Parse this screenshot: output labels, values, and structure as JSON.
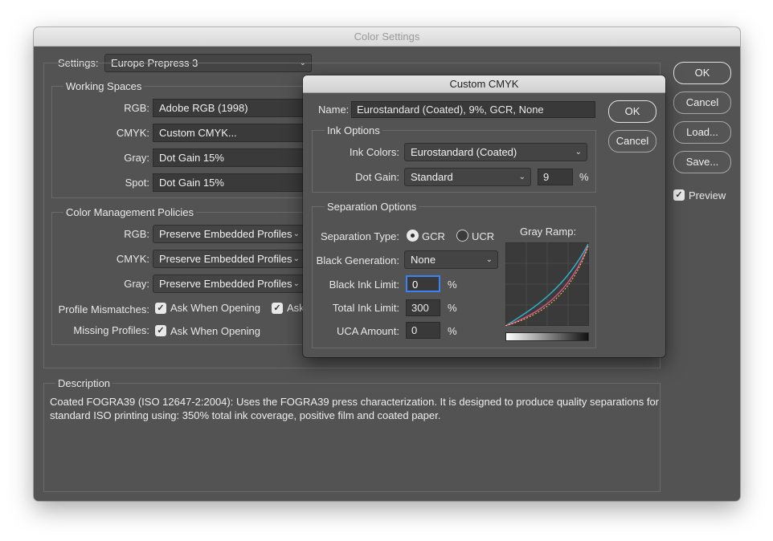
{
  "window": {
    "title": "Color Settings"
  },
  "settings": {
    "label": "Settings:",
    "value": "Europe Prepress 3"
  },
  "working_spaces": {
    "title": "Working Spaces",
    "rows": [
      {
        "label": "RGB:",
        "value": "Adobe RGB (1998)"
      },
      {
        "label": "CMYK:",
        "value": "Custom CMYK..."
      },
      {
        "label": "Gray:",
        "value": "Dot Gain 15%"
      },
      {
        "label": "Spot:",
        "value": "Dot Gain 15%"
      }
    ]
  },
  "policies": {
    "title": "Color Management Policies",
    "rows": [
      {
        "label": "RGB:",
        "value": "Preserve Embedded Profiles"
      },
      {
        "label": "CMYK:",
        "value": "Preserve Embedded Profiles"
      },
      {
        "label": "Gray:",
        "value": "Preserve Embedded Profiles"
      }
    ],
    "profile_mismatches": {
      "label": "Profile Mismatches:",
      "opt1": "Ask When Opening",
      "opt2": "Ask"
    },
    "missing_profiles": {
      "label": "Missing Profiles:",
      "opt1": "Ask When Opening"
    }
  },
  "description": {
    "title": "Description",
    "line1": "Coated FOGRA39 (ISO 12647-2:2004):  Uses the FOGRA39 press characterization. It is designed to produce quality separations for",
    "line2": "standard ISO printing using: 350% total ink coverage, positive film and coated paper."
  },
  "buttons": {
    "ok": "OK",
    "cancel": "Cancel",
    "load": "Load...",
    "save": "Save...",
    "preview": "Preview"
  },
  "custom_cmyk": {
    "title": "Custom CMYK",
    "name_label": "Name:",
    "name_value": "Eurostandard (Coated), 9%, GCR, None",
    "ok": "OK",
    "cancel": "Cancel",
    "ink_options": {
      "title": "Ink Options",
      "ink_colors_label": "Ink Colors:",
      "ink_colors_value": "Eurostandard (Coated)",
      "dot_gain_label": "Dot Gain:",
      "dot_gain_value": "Standard",
      "dot_gain_amount": "9",
      "percent": "%"
    },
    "separation": {
      "title": "Separation Options",
      "type_label": "Separation Type:",
      "gcr": "GCR",
      "ucr": "UCR",
      "black_gen_label": "Black Generation:",
      "black_gen_value": "None",
      "black_ink_label": "Black Ink Limit:",
      "black_ink_value": "0",
      "total_ink_label": "Total Ink Limit:",
      "total_ink_value": "300",
      "uca_label": "UCA Amount:",
      "uca_value": "0",
      "percent": "%",
      "gray_ramp_label": "Gray Ramp:"
    }
  },
  "colors": {
    "window_bg": "#535353",
    "field_bg": "#3a3a3a",
    "focus": "#3b82f6",
    "cyan_curve": "#2bb3c8",
    "magenta_curve": "#d94f8a",
    "yellow_curve": "#e8d34a"
  }
}
